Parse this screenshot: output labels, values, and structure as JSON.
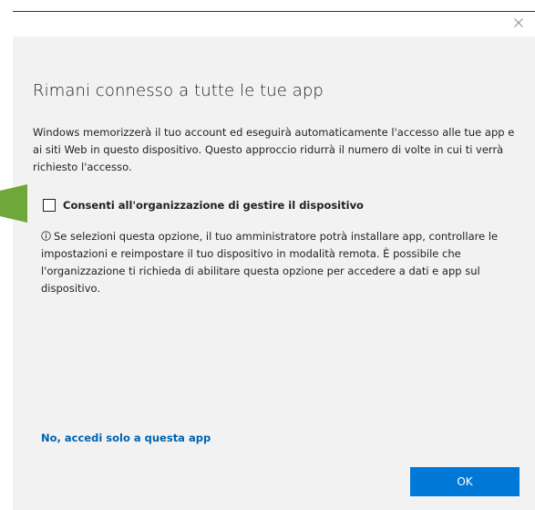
{
  "dialog": {
    "title": "Rimani connesso a tutte le tue app",
    "description": "Windows memorizzerà il tuo account ed eseguirà automaticamente l'accesso alle tue app e ai siti Web in questo dispositivo. Questo approccio ridurrà il numero di volte in cui ti verrà richiesto l'accesso.",
    "checkbox": {
      "label": "Consenti all'organizzazione di gestire il dispositivo",
      "checked": false
    },
    "info_text": "Se selezioni questa opzione, il tuo amministratore potrà installare app, controllare le impostazioni e reimpostare il tuo dispositivo in modalità remota. È possibile che l'organizzazione ti richieda di abilitare questa opzione per accedere a dati e app sul dispositivo.",
    "link_label": "No, accedi solo a questa app",
    "ok_label": "OK"
  },
  "colors": {
    "accent": "#0078d7",
    "link": "#0063b1",
    "dialog_background": "#f2f2f2",
    "arrow": "#6fa83a",
    "top_line": "#1f3d5c"
  },
  "icons": {
    "close": "close-icon",
    "info": "info-icon",
    "pointer": "arrow-pointer"
  }
}
